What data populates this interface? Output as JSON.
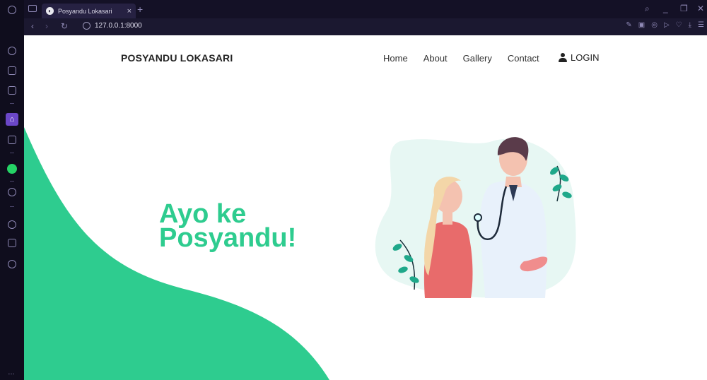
{
  "browser": {
    "tab_title": "Posyandu Lokasari",
    "new_tab": "+",
    "tab_close": "×",
    "url": "127.0.0.1:8000",
    "window_controls": [
      "search-icon",
      "minimize-icon",
      "restore-icon",
      "close-icon"
    ]
  },
  "site": {
    "brand": "POSYANDU LOKASARI",
    "nav": [
      {
        "label": "Home"
      },
      {
        "label": "About"
      },
      {
        "label": "Gallery"
      },
      {
        "label": "Contact"
      }
    ],
    "login": "LOGIN",
    "hero_line1": "Ayo ke",
    "hero_line2": "Posyandu!"
  },
  "colors": {
    "accent_green": "#2ecc8f",
    "browser_dark": "#141126",
    "sidebar_active": "#6b47c8"
  }
}
